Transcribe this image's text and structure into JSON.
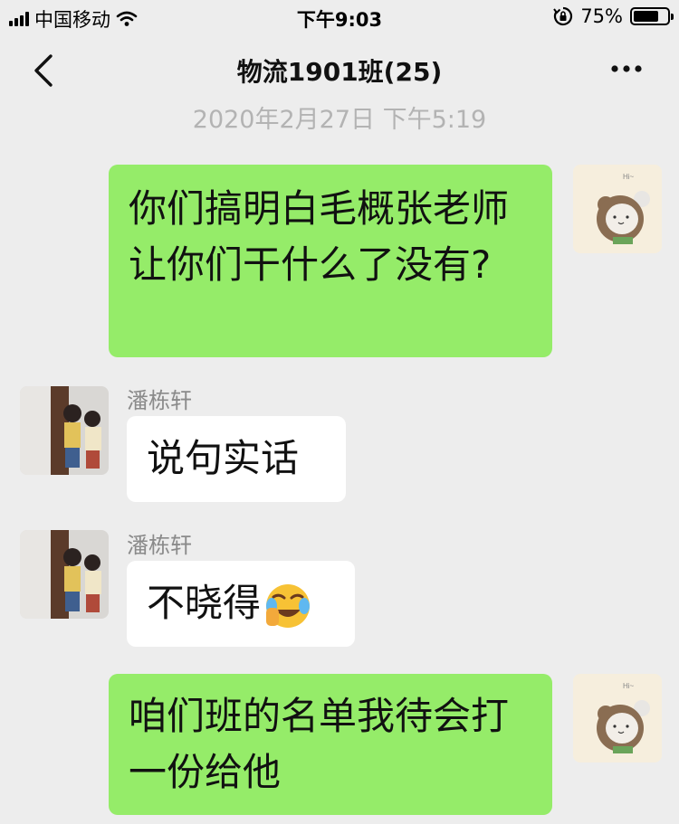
{
  "status_bar": {
    "carrier": "中国移动",
    "time": "下午9:03",
    "battery_percent": "75%",
    "battery_level": 0.75,
    "icons": [
      "signal-bars-icon",
      "wifi-icon",
      "rotation-lock-icon",
      "battery-icon"
    ]
  },
  "nav": {
    "title": "物流1901班(25)",
    "back_icon": "chevron-left-icon",
    "more_icon": "more-dots-icon"
  },
  "timestamp": "2020年2月27日 下午5:19",
  "messages": [
    {
      "side": "right",
      "text": "你们搞明白毛概张老师让你们干什么了没有?"
    },
    {
      "side": "left",
      "sender": "潘栋轩",
      "text": "说句实话"
    },
    {
      "side": "left",
      "sender": "潘栋轩",
      "text": "不晓得",
      "emoji": "face-with-tears-of-joy-icon"
    },
    {
      "side": "right",
      "text": "咱们班的名单我待会打一份给他"
    }
  ],
  "colors": {
    "background": "#ededed",
    "green_bubble": "#95ec69",
    "white_bubble": "#ffffff",
    "timestamp_text": "#b3b3b3"
  }
}
